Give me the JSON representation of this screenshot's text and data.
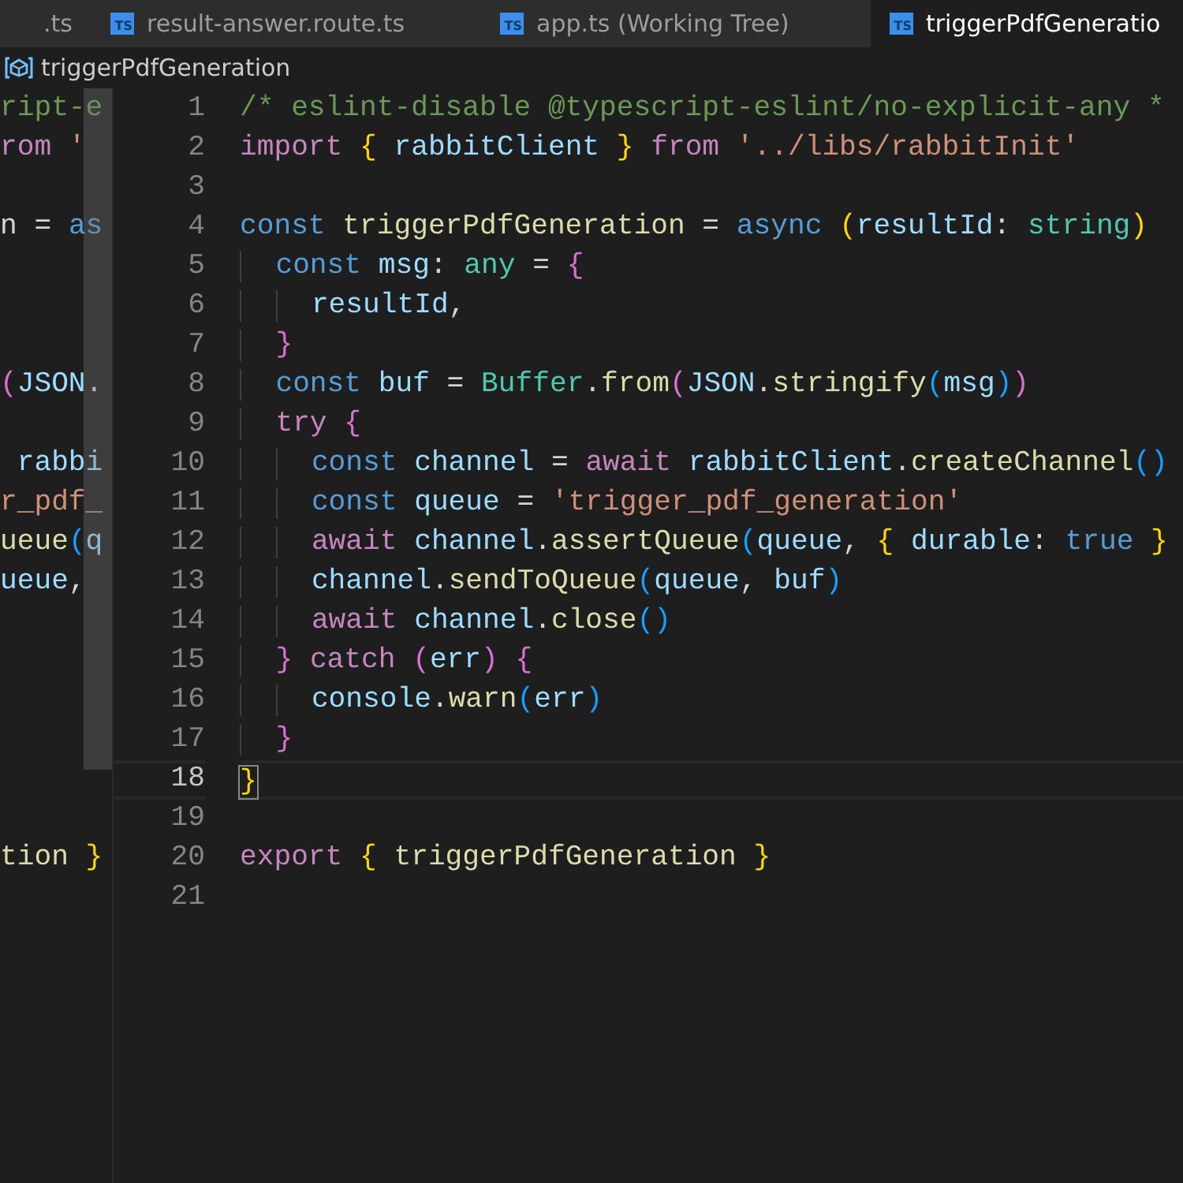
{
  "tabs": [
    {
      "label": ".ts",
      "has_icon": false,
      "selected": false
    },
    {
      "label": "result-answer.route.ts",
      "has_icon": true,
      "icon_text": "TS",
      "selected": false
    },
    {
      "label": "app.ts (Working Tree)",
      "has_icon": true,
      "icon_text": "TS",
      "selected": false
    },
    {
      "label": "triggerPdfGeneratio",
      "has_icon": true,
      "icon_text": "TS",
      "selected": true
    }
  ],
  "breadcrumb": {
    "label": "triggerPdfGeneration"
  },
  "editor": {
    "rows": [
      {
        "left_pane": [
          {
            "text": "ript-e",
            "kind": "comment"
          }
        ],
        "number": "1",
        "current": false,
        "tokens": [
          {
            "text": "/* eslint-disable @typescript-eslint/no-explicit-any *",
            "kind": "comment"
          }
        ]
      },
      {
        "left_pane": [
          {
            "text": "rom",
            "kind": "control"
          },
          {
            "text": " '",
            "kind": "string"
          }
        ],
        "number": "2",
        "current": false,
        "tokens": [
          {
            "text": "import ",
            "kind": "control"
          },
          {
            "text": "{",
            "kind": "brace1"
          },
          {
            "text": " rabbitClient ",
            "kind": "var"
          },
          {
            "text": "} ",
            "kind": "brace1"
          },
          {
            "text": "from",
            "kind": "control"
          },
          {
            "text": " '../libs/rabbitInit'",
            "kind": "string"
          }
        ]
      },
      {
        "number": "3",
        "current": false
      },
      {
        "left_pane": [
          {
            "text": "n = ",
            "kind": "plain"
          },
          {
            "text": "as",
            "kind": "keyword"
          }
        ],
        "number": "4",
        "current": false,
        "tokens": [
          {
            "text": "const",
            "kind": "keyword"
          },
          {
            "text": " triggerPdfGeneration",
            "kind": "func"
          },
          {
            "text": " = ",
            "kind": "plain"
          },
          {
            "text": "async ",
            "kind": "keyword"
          },
          {
            "text": "(",
            "kind": "brace1"
          },
          {
            "text": "resultId",
            "kind": "var"
          },
          {
            "text": ": ",
            "kind": "plain"
          },
          {
            "text": "string",
            "kind": "type"
          },
          {
            "text": ")",
            "kind": "brace1"
          }
        ]
      },
      {
        "number": "5",
        "current": false,
        "tokens": [
          {
            "text": "  const",
            "kind": "keyword"
          },
          {
            "text": " msg",
            "kind": "var"
          },
          {
            "text": ": ",
            "kind": "plain"
          },
          {
            "text": "any",
            "kind": "type"
          },
          {
            "text": " = ",
            "kind": "plain"
          },
          {
            "text": "{",
            "kind": "brace2"
          }
        ]
      },
      {
        "number": "6",
        "current": false,
        "tokens": [
          {
            "text": "    resultId",
            "kind": "var"
          },
          {
            "text": ",",
            "kind": "plain"
          }
        ]
      },
      {
        "number": "7",
        "current": false,
        "tokens": [
          {
            "text": "  }",
            "kind": "brace2"
          }
        ]
      },
      {
        "left_pane": [
          {
            "text": "(",
            "kind": "brace2"
          },
          {
            "text": "JSON",
            "kind": "var"
          },
          {
            "text": ".",
            "kind": "plain"
          }
        ],
        "number": "8",
        "current": false,
        "tokens": [
          {
            "text": "  const",
            "kind": "keyword"
          },
          {
            "text": " buf",
            "kind": "var"
          },
          {
            "text": " = ",
            "kind": "plain"
          },
          {
            "text": "Buffer",
            "kind": "type"
          },
          {
            "text": ".",
            "kind": "plain"
          },
          {
            "text": "from",
            "kind": "func"
          },
          {
            "text": "(",
            "kind": "brace2"
          },
          {
            "text": "JSON",
            "kind": "var"
          },
          {
            "text": ".",
            "kind": "plain"
          },
          {
            "text": "stringify",
            "kind": "func"
          },
          {
            "text": "(",
            "kind": "brace3"
          },
          {
            "text": "msg",
            "kind": "var"
          },
          {
            "text": ")",
            "kind": "brace3"
          },
          {
            "text": ")",
            "kind": "brace2"
          }
        ]
      },
      {
        "number": "9",
        "current": false,
        "tokens": [
          {
            "text": "  try ",
            "kind": "control"
          },
          {
            "text": "{",
            "kind": "brace2"
          }
        ]
      },
      {
        "left_pane": [
          {
            "text": " rabbi",
            "kind": "var"
          }
        ],
        "number": "10",
        "current": false,
        "tokens": [
          {
            "text": "    const",
            "kind": "keyword"
          },
          {
            "text": " channel",
            "kind": "var"
          },
          {
            "text": " = ",
            "kind": "plain"
          },
          {
            "text": "await",
            "kind": "control"
          },
          {
            "text": " rabbitClient",
            "kind": "var"
          },
          {
            "text": ".",
            "kind": "plain"
          },
          {
            "text": "createChannel",
            "kind": "func"
          },
          {
            "text": "()",
            "kind": "brace3"
          }
        ]
      },
      {
        "left_pane": [
          {
            "text": "r_pdf_",
            "kind": "string"
          }
        ],
        "number": "11",
        "current": false,
        "tokens": [
          {
            "text": "    const",
            "kind": "keyword"
          },
          {
            "text": " queue",
            "kind": "var"
          },
          {
            "text": " = ",
            "kind": "plain"
          },
          {
            "text": "'trigger_pdf_generation'",
            "kind": "string"
          }
        ]
      },
      {
        "left_pane": [
          {
            "text": "ueue",
            "kind": "func"
          },
          {
            "text": "(",
            "kind": "brace3"
          },
          {
            "text": "q",
            "kind": "var"
          }
        ],
        "number": "12",
        "current": false,
        "tokens": [
          {
            "text": "    await",
            "kind": "control"
          },
          {
            "text": " channel",
            "kind": "var"
          },
          {
            "text": ".",
            "kind": "plain"
          },
          {
            "text": "assertQueue",
            "kind": "func"
          },
          {
            "text": "(",
            "kind": "brace3"
          },
          {
            "text": "queue",
            "kind": "var"
          },
          {
            "text": ", ",
            "kind": "plain"
          },
          {
            "text": "{",
            "kind": "brace1"
          },
          {
            "text": " durable",
            "kind": "var"
          },
          {
            "text": ": ",
            "kind": "plain"
          },
          {
            "text": "true ",
            "kind": "keyword"
          },
          {
            "text": "}",
            "kind": "brace1"
          }
        ]
      },
      {
        "left_pane": [
          {
            "text": "ueue",
            "kind": "var"
          },
          {
            "text": ",",
            "kind": "plain"
          }
        ],
        "number": "13",
        "current": false,
        "tokens": [
          {
            "text": "    channel",
            "kind": "var"
          },
          {
            "text": ".",
            "kind": "plain"
          },
          {
            "text": "sendToQueue",
            "kind": "func"
          },
          {
            "text": "(",
            "kind": "brace3"
          },
          {
            "text": "queue",
            "kind": "var"
          },
          {
            "text": ", ",
            "kind": "plain"
          },
          {
            "text": "buf",
            "kind": "var"
          },
          {
            "text": ")",
            "kind": "brace3"
          }
        ]
      },
      {
        "number": "14",
        "current": false,
        "tokens": [
          {
            "text": "    await",
            "kind": "control"
          },
          {
            "text": " channel",
            "kind": "var"
          },
          {
            "text": ".",
            "kind": "plain"
          },
          {
            "text": "close",
            "kind": "func"
          },
          {
            "text": "()",
            "kind": "brace3"
          }
        ]
      },
      {
        "number": "15",
        "current": false,
        "tokens": [
          {
            "text": "  } ",
            "kind": "brace2"
          },
          {
            "text": "catch ",
            "kind": "control"
          },
          {
            "text": "(",
            "kind": "brace2"
          },
          {
            "text": "err",
            "kind": "var"
          },
          {
            "text": ") ",
            "kind": "brace2"
          },
          {
            "text": "{",
            "kind": "brace2"
          }
        ]
      },
      {
        "number": "16",
        "current": false,
        "tokens": [
          {
            "text": "    console",
            "kind": "var"
          },
          {
            "text": ".",
            "kind": "plain"
          },
          {
            "text": "warn",
            "kind": "func"
          },
          {
            "text": "(",
            "kind": "brace3"
          },
          {
            "text": "err",
            "kind": "var"
          },
          {
            "text": ")",
            "kind": "brace3"
          }
        ]
      },
      {
        "number": "17",
        "current": false,
        "tokens": [
          {
            "text": "  }",
            "kind": "brace2"
          }
        ]
      },
      {
        "number": "18",
        "current": true,
        "tokens": [
          {
            "text": "}",
            "kind": "brace1"
          }
        ]
      },
      {
        "number": "19",
        "current": false
      },
      {
        "left_pane": [
          {
            "text": "tion ",
            "kind": "func"
          },
          {
            "text": "}",
            "kind": "brace1"
          }
        ],
        "number": "20",
        "current": false,
        "tokens": [
          {
            "text": "export ",
            "kind": "control"
          },
          {
            "text": "{",
            "kind": "brace1"
          },
          {
            "text": " triggerPdfGeneration ",
            "kind": "func"
          },
          {
            "text": "}",
            "kind": "brace1"
          }
        ]
      },
      {
        "number": "21",
        "current": false
      }
    ]
  }
}
